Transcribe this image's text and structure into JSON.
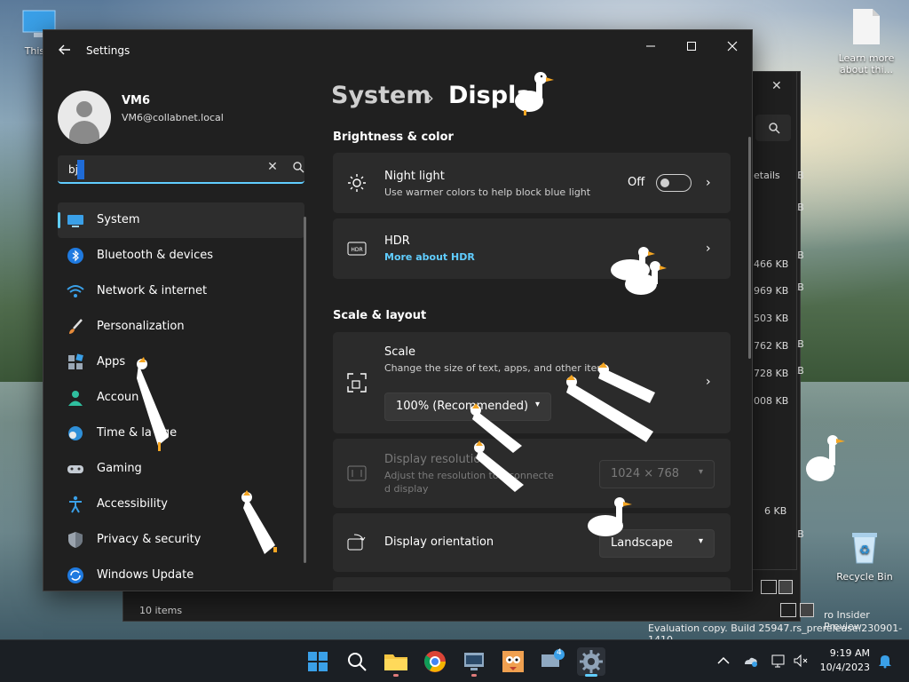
{
  "desktop": {
    "icons": [
      {
        "label": "This P"
      },
      {
        "label": "Learn more about thi..."
      },
      {
        "label": "Recycle Bin"
      }
    ],
    "watermark": {
      "line1": "ro Insider Preview",
      "line2": "Evaluation copy. Build 25947.rs_prerelease.230901-1410"
    }
  },
  "explorer": {
    "details_label": "etails",
    "sizes": [
      "466 KB",
      "969 KB",
      "503 KB",
      "762 KB",
      "728 KB",
      "008 KB",
      "6 KB"
    ],
    "side_kb": [
      "KB",
      "KB",
      "KB",
      "KB",
      "KB",
      "KB",
      "KB"
    ],
    "status": "10 items"
  },
  "settings": {
    "title": "Settings",
    "profile": {
      "name": "VM6",
      "email": "VM6@collabnet.local"
    },
    "search": {
      "value": "bj"
    },
    "nav": [
      {
        "label": "System"
      },
      {
        "label": "Bluetooth & devices"
      },
      {
        "label": "Network & internet"
      },
      {
        "label": "Personalization"
      },
      {
        "label": "Apps"
      },
      {
        "label": "Accoun"
      },
      {
        "label": "Time & la      age"
      },
      {
        "label": "Gaming"
      },
      {
        "label": "Accessibility"
      },
      {
        "label": "Privacy & security"
      },
      {
        "label": "Windows Update"
      }
    ],
    "breadcrumb": {
      "parent": "System",
      "sep": "›",
      "current": "Displa"
    },
    "sections": {
      "brightness": "Brightness & color",
      "scale_layout": "Scale & layout"
    },
    "night_light": {
      "title": "Night light",
      "desc": "Use warmer colors to help block blue light",
      "state": "Off"
    },
    "hdr": {
      "title": "HDR",
      "link": "More about HDR"
    },
    "scale": {
      "title": "Scale",
      "desc": "Change the size of text, apps, and other item",
      "value": "100% (Recommended)"
    },
    "resolution": {
      "title": "Display resolution",
      "desc1": "Adjust the resolution to      r connecte",
      "desc2": "d display",
      "value": "1024 × 768"
    },
    "orientation": {
      "title": "Display orientation",
      "value": "Landscape"
    }
  },
  "taskbar": {
    "time": "9:19 AM",
    "date": "10/4/2023",
    "badge": "4"
  }
}
